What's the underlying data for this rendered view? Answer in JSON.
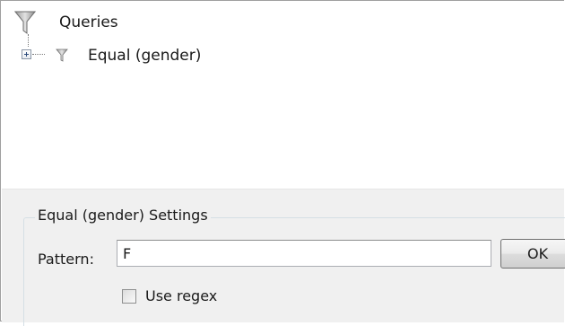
{
  "tree": {
    "root": {
      "label": "Queries",
      "icon": "funnel-icon"
    },
    "children": [
      {
        "label": "Equal (gender)",
        "icon": "funnel-icon",
        "expander": "plus"
      }
    ]
  },
  "settings": {
    "group_title": "Equal (gender) Settings",
    "pattern_label": "Pattern:",
    "pattern_value": "F",
    "ok_label": "OK",
    "use_regex_label": "Use regex",
    "use_regex_checked": false
  },
  "colors": {
    "tree_background": "#ffffff",
    "panel_background": "#f0f0f0"
  }
}
